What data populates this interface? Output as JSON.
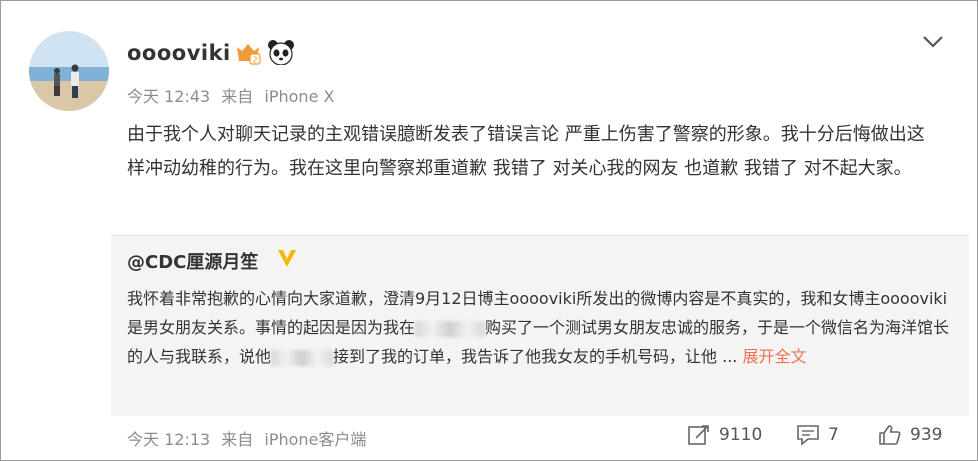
{
  "post": {
    "username": "ooooviki",
    "meta": {
      "time": "今天 12:43",
      "source_prefix": "来自",
      "source": "iPhone X"
    },
    "text": "由于我个人对聊天记录的主观错误臆断发表了错误言论 严重上伤害了警察的形象。我十分后悔做出这样冲动幼稚的行为。我在这里向警察郑重道歉 我错了 对关心我的网友 也道歉 我错了 对不起大家。"
  },
  "repost": {
    "author": "@CDC厘源月笙",
    "text_part1": "我怀着非常抱歉的心情向大家道歉，澄清9月12日博主ooooviki所发出的微博内容是不真实的，我和女博主ooooviki是男女朋友关系。事情的起因是因为我在",
    "text_part2": "购买了一个测试男女朋友忠诚的服务，于是一个微信名为海洋馆长的人与我联系，说他",
    "text_part3": "接到了我的订单，我告诉了他我女友的手机号码，让他",
    "ellipsis": "...",
    "expand_label": "展开全文"
  },
  "footer": {
    "time": "今天 12:13",
    "source_prefix": "来自",
    "source": "iPhone客户端",
    "reposts": "9110",
    "comments": "7",
    "likes": "939"
  },
  "icons": {
    "avatar": "avatar-beach-photo",
    "vip": "vip-badge-icon",
    "panda": "panda-badge-icon",
    "chevron": "chevron-down-icon",
    "verified": "verified-v-icon",
    "repost": "repost-icon",
    "comment": "comment-icon",
    "like": "like-icon"
  },
  "colors": {
    "accent": "#eb7350",
    "verified": "#f5b800",
    "meta": "#8c8c8c"
  }
}
